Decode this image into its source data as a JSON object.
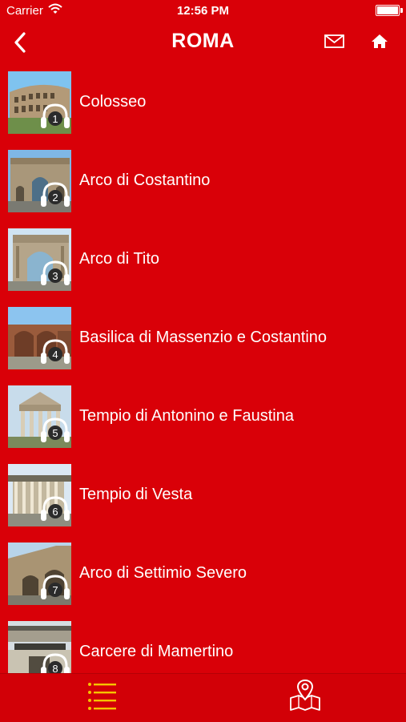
{
  "status_bar": {
    "carrier": "Carrier",
    "time": "12:56 PM"
  },
  "nav": {
    "title": "ROMA"
  },
  "items": [
    {
      "number": "1",
      "label": "Colosseo"
    },
    {
      "number": "2",
      "label": "Arco di Costantino"
    },
    {
      "number": "3",
      "label": "Arco di Tito"
    },
    {
      "number": "4",
      "label": "Basilica di Massenzio e Costantino"
    },
    {
      "number": "5",
      "label": "Tempio di Antonino e Faustina"
    },
    {
      "number": "6",
      "label": "Tempio di Vesta"
    },
    {
      "number": "7",
      "label": "Arco di Settimio Severo"
    },
    {
      "number": "8",
      "label": "Carcere di Mamertino"
    }
  ],
  "colors": {
    "background": "#d90008",
    "text": "#ffffff",
    "active_tab": "#f5c400"
  },
  "icons": {
    "back": "chevron-left-icon",
    "mail": "mail-icon",
    "home": "home-icon",
    "list_tab": "list-icon",
    "map_tab": "map-pin-icon",
    "audio": "headphones-icon"
  }
}
